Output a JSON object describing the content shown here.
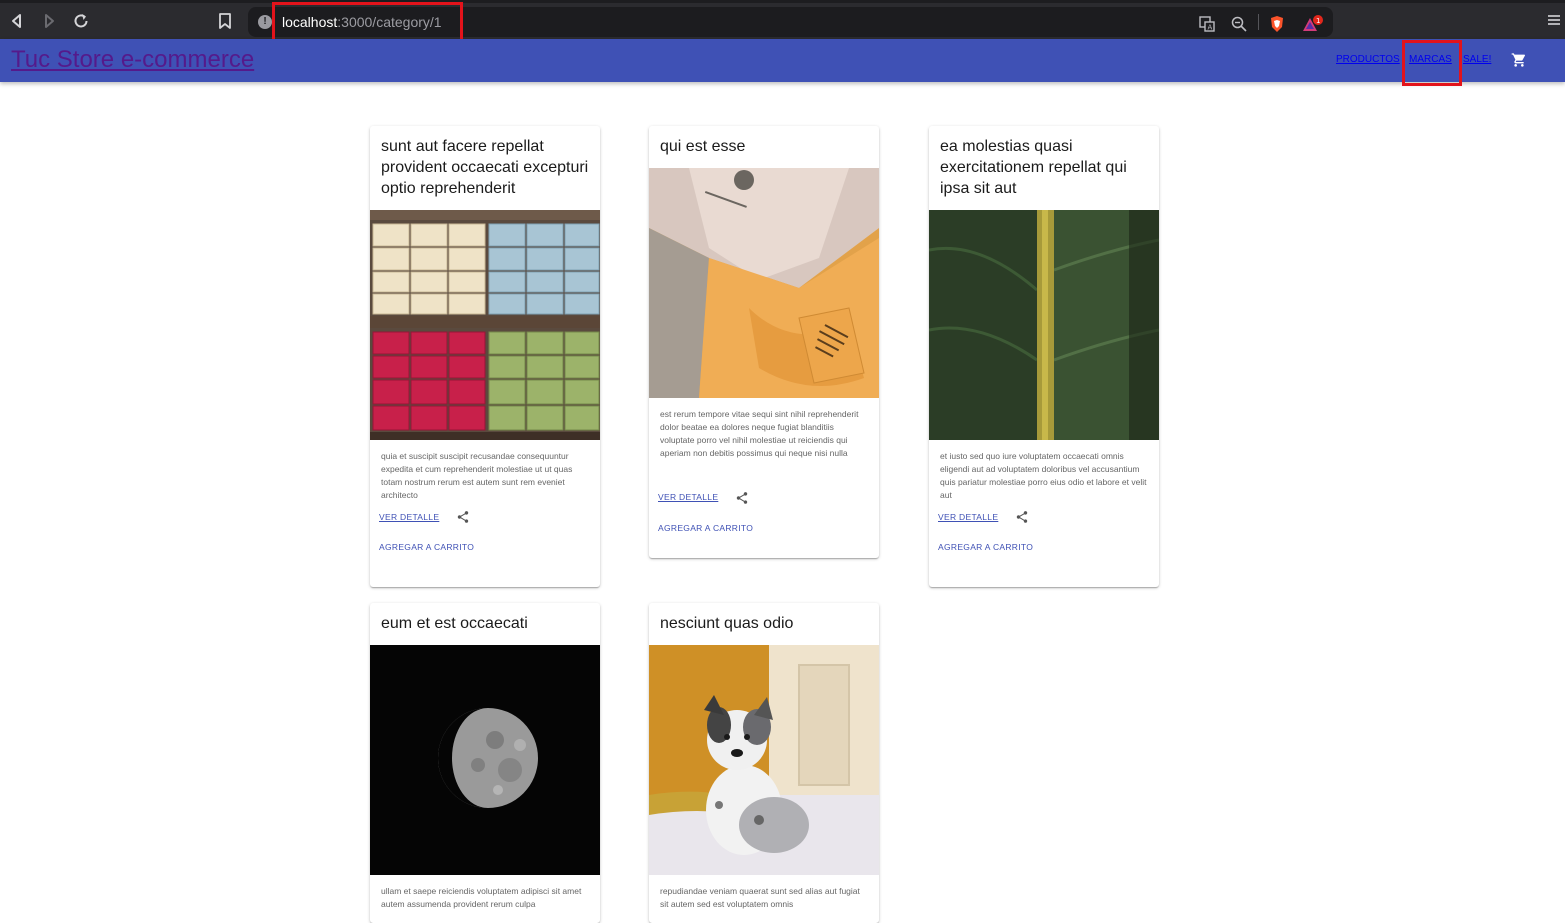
{
  "browser": {
    "url_host": "localhost",
    "url_path": ":3000/category/1",
    "extension_badge": "1"
  },
  "header": {
    "brand": "Tuc Store e-commerce",
    "nav": [
      "PRODUCTOS",
      "MARCAS",
      "SALE!"
    ]
  },
  "products": [
    {
      "title": "sunt aut facere repellat provident occaecati excepturi optio reprehenderit",
      "body": "quia et suscipit suscipit recusandae consequuntur expedita et cum reprehenderit molestiae ut ut quas totam nostrum rerum est autem sunt rem eveniet architecto",
      "detail_label": "VER DETALLE",
      "cart_label": "AGREGAR A CARRITO",
      "image": "soap-shelves"
    },
    {
      "title": "qui est esse",
      "body": "est rerum tempore vitae sequi sint nihil reprehenderit dolor beatae ea dolores neque fugiat blanditiis voluptate porro vel nihil molestiae ut reiciendis qui aperiam non debitis possimus qui neque nisi nulla",
      "detail_label": "VER DETALLE",
      "cart_label": "AGREGAR A CARRITO",
      "image": "folded-shirts"
    },
    {
      "title": "ea molestias quasi exercitationem repellat qui ipsa sit aut",
      "body": "et iusto sed quo iure voluptatem occaecati omnis eligendi aut ad voluptatem doloribus vel accusantium quis pariatur molestiae porro eius odio et labore et velit aut",
      "detail_label": "VER DETALLE",
      "cart_label": "AGREGAR A CARRITO",
      "image": "green-leaf"
    },
    {
      "title": "eum et est occaecati",
      "body": "ullam et saepe reiciendis voluptatem adipisci sit amet autem assumenda provident rerum culpa",
      "image": "moon"
    },
    {
      "title": "nesciunt quas odio",
      "body": "repudiandae veniam quaerat sunt sed alias aut fugiat sit autem sed est voluptatem omnis",
      "image": "puppy"
    }
  ],
  "colors": {
    "appbar": "#3f51b5",
    "highlight": "#e3131b"
  }
}
